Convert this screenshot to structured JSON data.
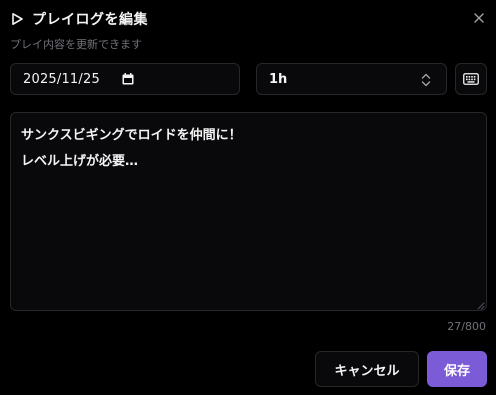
{
  "dialog": {
    "title": "プレイログを編集",
    "subtitle": "プレイ内容を更新できます",
    "icons": {
      "title": "play-icon",
      "close": "close-icon"
    }
  },
  "form": {
    "date": {
      "value": "2025/11/25",
      "icon": "calendar-icon"
    },
    "duration": {
      "value": "1h",
      "icon": "chevron-updown-icon"
    },
    "keyboard_icon": "keyboard-icon",
    "memo": {
      "value": "サンクスビギングでロイドを仲間に！\nレベル上げが必要…",
      "counter": "27/800"
    }
  },
  "actions": {
    "cancel_label": "キャンセル",
    "save_label": "保存"
  },
  "colors": {
    "background": "#000000",
    "field_background": "#09090b",
    "border": "#27272a",
    "text": "#f4f4f5",
    "muted": "#71717a",
    "accent": "#7c5bd6"
  }
}
